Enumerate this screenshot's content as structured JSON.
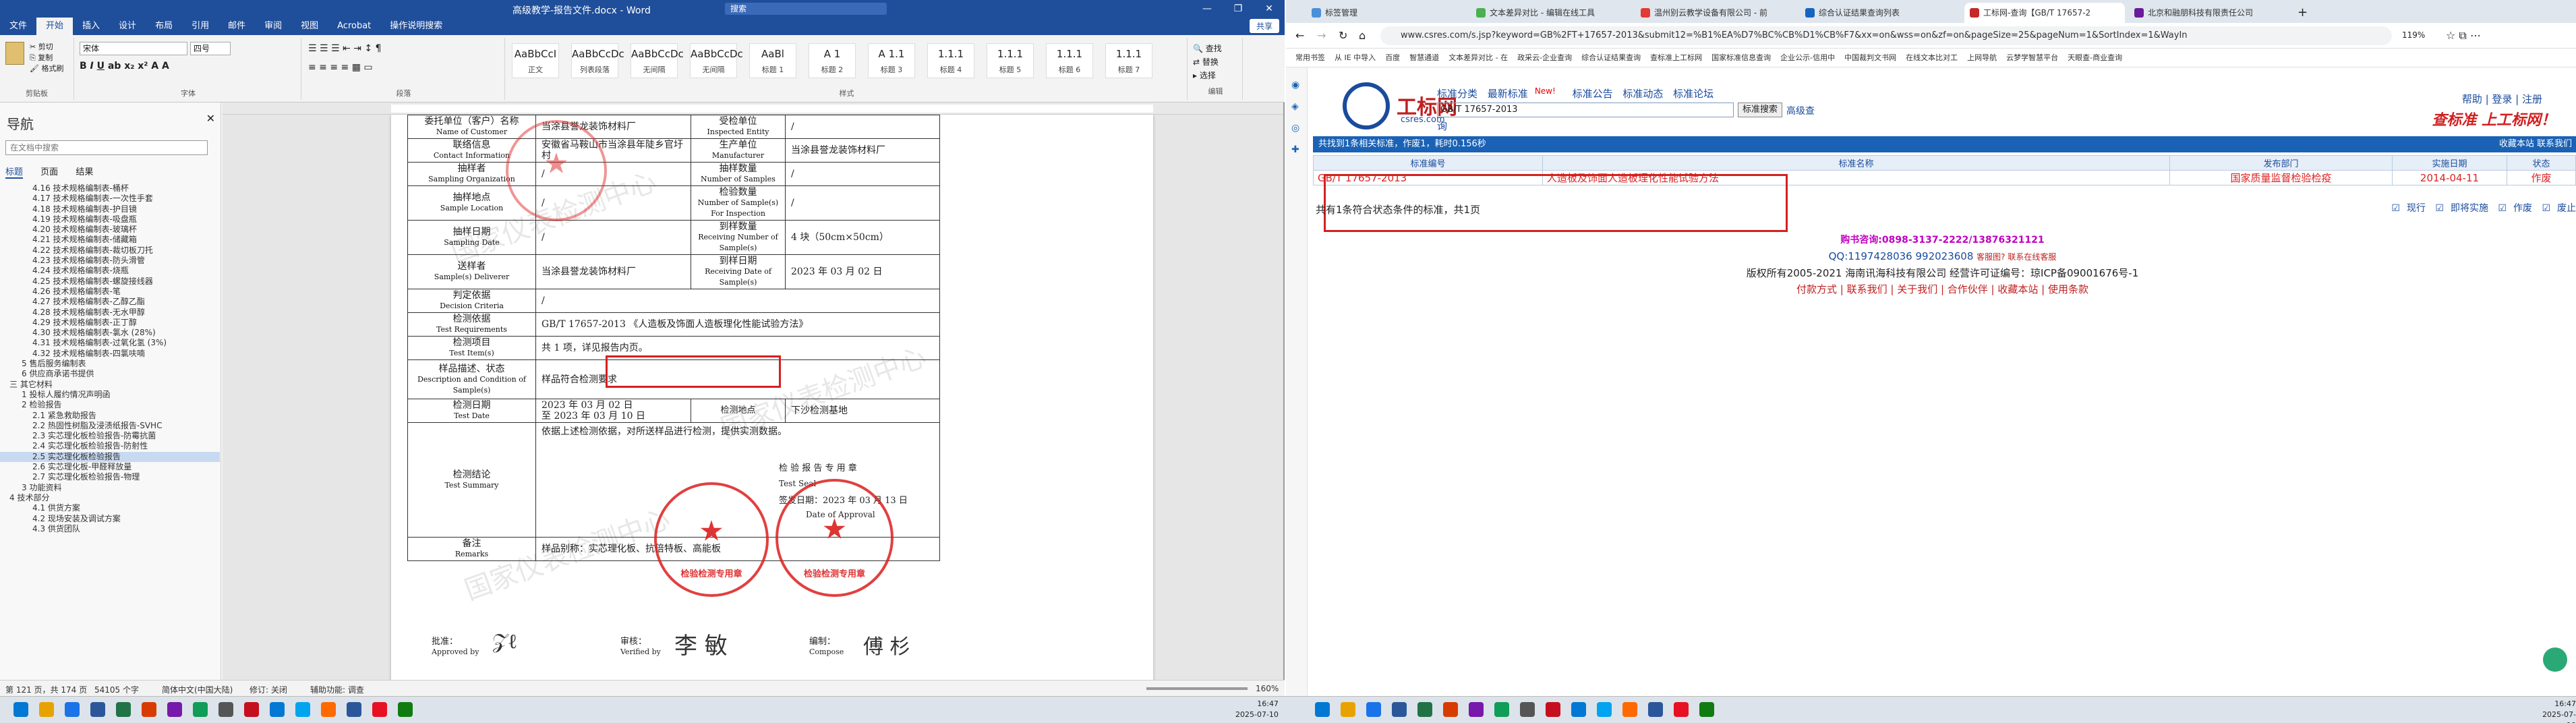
{
  "word": {
    "title": "高级教学-报告文件.docx - Word",
    "search_placeholder": "搜索",
    "tabs": [
      "文件",
      "开始",
      "插入",
      "设计",
      "布局",
      "引用",
      "邮件",
      "审阅",
      "视图",
      "Acrobat",
      "操作说明搜索"
    ],
    "active_tab": "开始",
    "share_label": "共享",
    "font_name": "宋体",
    "font_size": "四号",
    "styles": [
      {
        "preview": "AaBbCcI",
        "name": "正文"
      },
      {
        "preview": "AaBbCcDc",
        "name": "列表段落"
      },
      {
        "preview": "AaBbCcDc",
        "name": "无间隔"
      },
      {
        "preview": "AaBbCcDc",
        "name": "无间隔"
      },
      {
        "preview": "AaBl",
        "name": "标题 1"
      },
      {
        "preview": "A 1",
        "name": "标题 2"
      },
      {
        "preview": "A 1.1",
        "name": "标题 3"
      },
      {
        "preview": "1.1.1",
        "name": "标题 4"
      },
      {
        "preview": "1.1.1",
        "name": "标题 5"
      },
      {
        "preview": "1.1.1",
        "name": "标题 6"
      },
      {
        "preview": "1.1.1",
        "name": "标题 7"
      }
    ],
    "group_labels": {
      "clipboard": "剪贴板",
      "font": "字体",
      "paragraph": "段落",
      "styles": "样式",
      "editing": "编辑"
    },
    "editing": [
      "查找",
      "替换",
      "选择"
    ],
    "nav": {
      "title": "导航",
      "search_placeholder": "在文档中搜索",
      "tabs": [
        "标题",
        "页面",
        "结果"
      ],
      "items": [
        {
          "t": "4.16 技术规格编制表-桶杯",
          "l": 3
        },
        {
          "t": "4.17 技术规格编制表-一次性手套",
          "l": 3
        },
        {
          "t": "4.18 技术规格编制表-护目镜",
          "l": 3
        },
        {
          "t": "4.19 技术规格编制表-吸盘瓶",
          "l": 3
        },
        {
          "t": "4.20 技术规格编制表-玻璃杯",
          "l": 3
        },
        {
          "t": "4.21 技术规格编制表-储藏箱",
          "l": 3
        },
        {
          "t": "4.22 技术规格编制表-裁切板刀托",
          "l": 3
        },
        {
          "t": "4.23 技术规格编制表-防头滑管",
          "l": 3
        },
        {
          "t": "4.24 技术规格编制表-烧瓶",
          "l": 3
        },
        {
          "t": "4.25 技术规格编制表-螺旋接线器",
          "l": 3
        },
        {
          "t": "4.26 技术规格编制表-笔",
          "l": 3
        },
        {
          "t": "4.27 技术规格编制表-乙醇乙酯",
          "l": 3
        },
        {
          "t": "4.28 技术规格编制表-无水甲醇",
          "l": 3
        },
        {
          "t": "4.29 技术规格编制表-正丁醇",
          "l": 3
        },
        {
          "t": "4.30 技术规格编制表-氯水 (28%)",
          "l": 3
        },
        {
          "t": "4.31 技术规格编制表-过氧化氢 (3%)",
          "l": 3
        },
        {
          "t": "4.32 技术规格编制表-四氯呋喃",
          "l": 3
        },
        {
          "t": "5 售后服务编制表",
          "l": 2
        },
        {
          "t": "6 供应商承诺书提供",
          "l": 2
        },
        {
          "t": "三 其它材料",
          "l": 1
        },
        {
          "t": "1 投标人履约情况声明函",
          "l": 2
        },
        {
          "t": "2 检验报告",
          "l": 2
        },
        {
          "t": "2.1 紧急救助报告",
          "l": 3
        },
        {
          "t": "2.2 热固性树脂及浸渍纸报告-SVHC",
          "l": 3
        },
        {
          "t": "2.3 实芯理化板检验报告-防霉抗菌",
          "l": 3
        },
        {
          "t": "2.4 实芯理化板检验报告-防射性",
          "l": 3
        },
        {
          "t": "2.5 实芯理化板检验报告",
          "l": 3,
          "sel": true
        },
        {
          "t": "2.6 实芯理化板-甲醛释放量",
          "l": 3
        },
        {
          "t": "2.7 实芯理化板检验报告-物理",
          "l": 3
        },
        {
          "t": "3 功能资料",
          "l": 2
        },
        {
          "t": "4 技术部分",
          "l": 1
        },
        {
          "t": "4.1 供货方案",
          "l": 3
        },
        {
          "t": "4.2 现场安装及调试方案",
          "l": 3
        },
        {
          "t": "4.3 供货团队",
          "l": 3
        }
      ]
    },
    "doc": {
      "rows": [
        {
          "l1": "委托单位（客户）名称",
          "e1": "Name of Customer",
          "v1": "当涂县誉龙装饰材料厂",
          "l2": "受检单位",
          "e2": "Inspected Entity",
          "v2": "/"
        },
        {
          "l1": "联络信息",
          "e1": "Contact Information",
          "v1": "安徽省马鞍山市当涂县年陡乡官圩村",
          "l2": "生产单位",
          "e2": "Manufacturer",
          "v2": "当涂县誉龙装饰材料厂"
        },
        {
          "l1": "抽样者",
          "e1": "Sampling Organization",
          "v1": "/",
          "l2": "抽样数量",
          "e2": "Number of Samples",
          "v2": "/"
        },
        {
          "l1": "抽样地点",
          "e1": "Sample Location",
          "v1": "/",
          "l2": "检验数量",
          "e2": "Number of Sample(s) For Inspection",
          "v2": "/"
        },
        {
          "l1": "抽样日期",
          "e1": "Sampling Date",
          "v1": "/",
          "l2": "到样数量",
          "e2": "Receiving Number of Sample(s)",
          "v2": "4 块（50cm×50cm）"
        },
        {
          "l1": "送样者",
          "e1": "Sample(s) Deliverer",
          "v1": "当涂县誉龙装饰材料厂",
          "l2": "到样日期",
          "e2": "Receiving Date of Sample(s)",
          "v2": "2023 年 03 月 02 日"
        }
      ],
      "decision": {
        "l": "判定依据",
        "e": "Decision Criteria",
        "v": "/"
      },
      "requirements": {
        "l": "检测依据",
        "e": "Test Requirements",
        "v": "GB/T 17657-2013 《人造板及饰面人造板理化性能试验方法》"
      },
      "items": {
        "l": "检测项目",
        "e": "Test Item(s)",
        "v": "共 1 项，详见报告内页。"
      },
      "desc": {
        "l": "样品描述、状态",
        "e": "Description and Condition of Sample(s)",
        "v": "样品符合检测要求"
      },
      "date": {
        "l": "检测日期",
        "e": "Test Date",
        "v1": "2023 年 03 月 02 日",
        "v2": "至  2023 年 03 月 10 日",
        "l2": "检测地点",
        "v3": "下沙检测基地"
      },
      "conclusion": {
        "l": "检测结论",
        "e": "Test Summary",
        "v": "依据上述检测依据，对所送样品进行检测，提供实测数据。",
        "sub": "检 验 报 告 专 用 章",
        "seal": "Test Seal",
        "issue": "签发日期：2023 年 03 月 13 日",
        "issue_en": "Date of Approval"
      },
      "remarks": {
        "l": "备注",
        "e": "Remarks",
        "v": "样品别称：实芯理化板、抗倍特板、高能板"
      },
      "sign": {
        "a": "批准：",
        "ae": "Approved by",
        "b": "审核：",
        "be": "Verified by",
        "c": "编制：",
        "ce": "Compose"
      },
      "stamp_text": "检验检测专用章"
    },
    "status": {
      "page": "第 121 页，共 174 页",
      "words": "54105 个字",
      "lang": "简体中文(中国大陆)",
      "track": "修订: 关闭",
      "access": "辅助功能: 调查",
      "zoom": "160%"
    }
  },
  "browser": {
    "tabs": [
      {
        "label": "标签管理",
        "fav": "#4a90d9"
      },
      {
        "label": "文本差异对比 - 编辑在线工具",
        "fav": "#4caf50"
      },
      {
        "label": "温州别云教学设备有限公司 - 前",
        "fav": "#e53935"
      },
      {
        "label": "综合认证结果查询列表",
        "fav": "#1565c0"
      },
      {
        "label": "工标网-查询【GB/T 17657-2",
        "fav": "#c62828",
        "active": true
      },
      {
        "label": "北京和融朋科技有限责任公司",
        "fav": "#6a1b9a"
      }
    ],
    "url": "www.csres.com/s.jsp?keyword=GB%2FT+17657-2013&submit12=%B1%EA%D7%BC%CB%D1%CB%F7&xx=on&wss=on&zf=on&pageSize=25&pageNum=1&SortIndex=1&WayIn",
    "zoom": "119%",
    "bookmarks": [
      "常用书签",
      "从 IE 中导入",
      "百度",
      "智慧通道",
      "文本差异对比 - 在",
      "政采云-企业查询",
      "综合认证结果查询",
      "查标准上工标网",
      "国家标准信息查询",
      "企业公示-信用中",
      "中国裁判文书网",
      "在线文本比对工",
      "上网导航",
      "云梦学智慧平台",
      "天眼查-商业查询"
    ],
    "site": {
      "logo_cn": "工标网",
      "logo_en": "csres.com",
      "nav": [
        "标准分类",
        "最新标准",
        "标准公告",
        "标准动态",
        "标准论坛"
      ],
      "new_badge": "New!",
      "search_value": "GB/T 17657-2013",
      "search_btn": "标准搜索",
      "adv": "高级查",
      "ci": "询",
      "topright": "帮助 | 登录 | 注册",
      "slogan": "查标准 上工标网！",
      "bar_left": "共找到1条相关标准，作废1，耗时0.156秒",
      "bar_right": "收藏本站  联系我们",
      "headers": [
        "标准编号",
        "标准名称",
        "发布部门",
        "实施日期",
        "状态"
      ],
      "row": [
        "GB/T 17657-2013",
        "人造板及饰面人造板理化性能试验方法",
        "国家质量监督检验检疫",
        "2014-04-11",
        "作废"
      ],
      "summary": "共有1条符合状态条件的标准，共1页",
      "filters": [
        "现行",
        "即将实施",
        "作废",
        "废止"
      ],
      "phone": "购书咨询:0898-3137-2222/13876321121",
      "qq": "QQ:1197428036 992023608",
      "qq_link": "客服图? 联系在线客服",
      "copyright": "版权所有2005-2021 海南讯海科技有限公司 经营许可证编号：琼ICP备09001676号-1",
      "links": "付款方式 | 联系我们 | 关于我们 | 合作伙伴 | 收藏本站 | 使用条款"
    }
  },
  "taskbar": {
    "time1": "16:47",
    "date1": "2025-07-10",
    "time2": "16:47",
    "date2": "2025-07-10"
  }
}
